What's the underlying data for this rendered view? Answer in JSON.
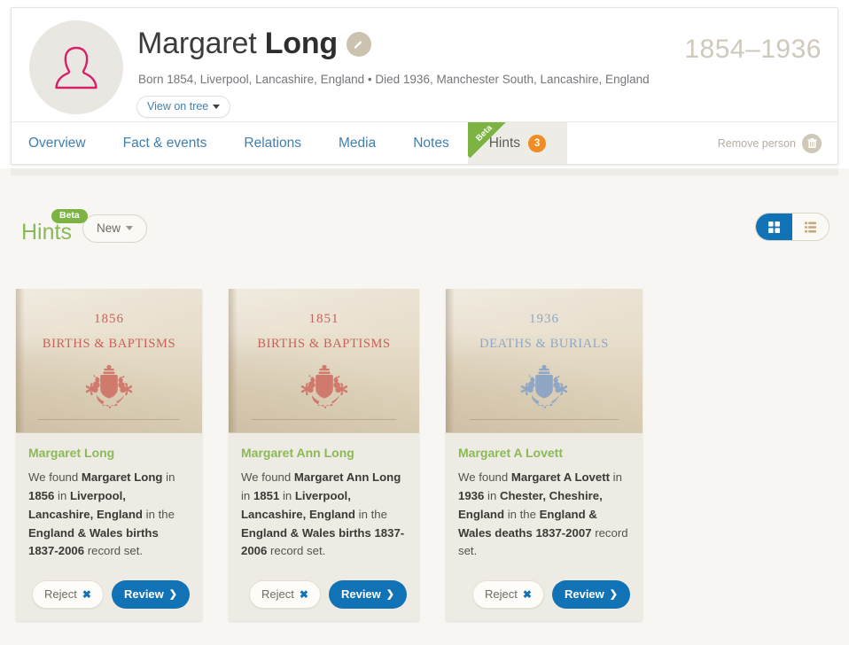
{
  "profile": {
    "avatar_icon": "female-silhouette-icon",
    "first_name": "Margaret ",
    "last_name": "Long",
    "edit_icon": "pencil-icon",
    "vitals": "Born 1854, Liverpool, Lancashire, England • Died 1936, Manchester South, Lancashire, England",
    "view_tree_label": "View on tree",
    "lifespan": "1854–1936"
  },
  "tabs": [
    {
      "label": "Overview",
      "active": false
    },
    {
      "label": "Fact & events",
      "active": false
    },
    {
      "label": "Relations",
      "active": false
    },
    {
      "label": "Media",
      "active": false
    },
    {
      "label": "Notes",
      "active": false
    },
    {
      "label": "Hints",
      "active": true,
      "ribbon": "Beta",
      "badge": "3"
    }
  ],
  "remove_person": {
    "label": "Remove person",
    "icon": "trash-icon"
  },
  "hints_section": {
    "beta_badge": "Beta",
    "title": "Hints",
    "filter_label": "New",
    "view_grid_icon": "grid-view-icon",
    "view_list_icon": "list-view-icon"
  },
  "colors": {
    "accent_blue": "#1272b6",
    "green": "#8aba56",
    "ribbon_green": "#7cb342",
    "badge_orange": "#f08c23",
    "pink": "#d6206a",
    "tan": "#cbc3b0"
  },
  "cards": [
    {
      "record_year": "1856",
      "record_type": "BIRTHS & BAPTISMS",
      "tone": "red",
      "name": "Margaret Long",
      "text_1": "We found ",
      "bold_1": "Margaret Long",
      "text_2": " in ",
      "bold_2": "1856",
      "text_3": " in ",
      "bold_3": "Liverpool, Lancashire, England",
      "text_4": " in the ",
      "bold_4": "England & Wales births 1837-2006",
      "text_5": " record set.",
      "reject_label": "Reject",
      "review_label": "Review"
    },
    {
      "record_year": "1851",
      "record_type": "BIRTHS & BAPTISMS",
      "tone": "red",
      "name": "Margaret Ann Long",
      "text_1": "We found ",
      "bold_1": "Margaret Ann Long",
      "text_2": " in ",
      "bold_2": "1851",
      "text_3": " in ",
      "bold_3": "Liverpool, Lancashire, England",
      "text_4": " in the ",
      "bold_4": "England & Wales births 1837-2006",
      "text_5": " record set.",
      "reject_label": "Reject",
      "review_label": "Review"
    },
    {
      "record_year": "1936",
      "record_type": "DEATHS & BURIALS",
      "tone": "blue",
      "name": "Margaret A Lovett",
      "text_1": "We found ",
      "bold_1": "Margaret A Lovett",
      "text_2": " in ",
      "bold_2": "1936",
      "text_3": " in ",
      "bold_3": "Chester, Cheshire, England",
      "text_4": " in the ",
      "bold_4": "England & Wales deaths 1837-2007",
      "text_5": " record set.",
      "reject_label": "Reject",
      "review_label": "Review"
    }
  ]
}
